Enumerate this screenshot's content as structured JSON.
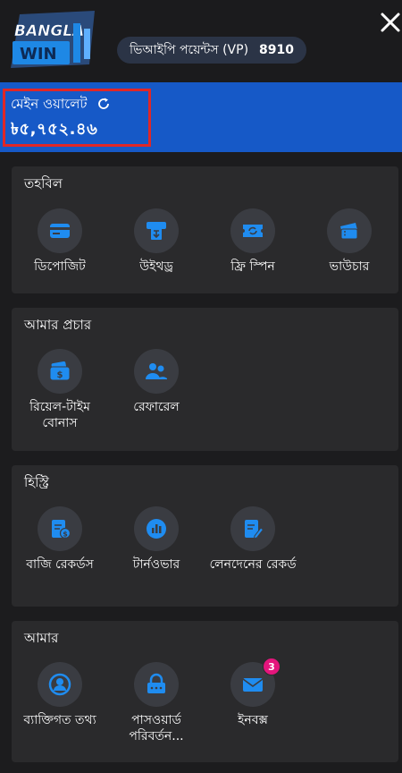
{
  "header": {
    "logo_text_top": "BANGLA",
    "logo_text_bottom": "WIN",
    "vip_label": "ভিআইপি পয়েন্টস (VP)",
    "vip_value": "8910",
    "close_icon": "close-icon"
  },
  "wallet": {
    "title": "মেইন ওয়ালেট",
    "amount": "৳৫,৭৫২.৪৬",
    "refresh_icon": "refresh-icon"
  },
  "sections": [
    {
      "title": "তহবিল",
      "items": [
        {
          "label": "ডিপোজিট",
          "icon": "card-icon"
        },
        {
          "label": "উইথড্র",
          "icon": "withdraw-icon"
        },
        {
          "label": "ফ্রি স্পিন",
          "icon": "ticket-icon"
        },
        {
          "label": "ভাউচার",
          "icon": "voucher-icon"
        }
      ]
    },
    {
      "title": "আমার প্রচার",
      "items": [
        {
          "label": "রিয়েল-টাইম বোনাস",
          "icon": "wallet-bonus-icon"
        },
        {
          "label": "রেফারেল",
          "icon": "referral-icon"
        }
      ]
    },
    {
      "title": "হিস্ট্রি",
      "items": [
        {
          "label": "বাজি রেকর্ডস",
          "icon": "bet-record-icon"
        },
        {
          "label": "টার্নওভার",
          "icon": "turnover-icon"
        },
        {
          "label": "লেনদেনের রেকর্ড",
          "icon": "transaction-record-icon"
        }
      ]
    },
    {
      "title": "আমার",
      "items": [
        {
          "label": "ব্যাক্তিগত তথ্য",
          "icon": "user-icon"
        },
        {
          "label": "পাসওয়ার্ড পরিবর্তন...",
          "icon": "lock-icon"
        },
        {
          "label": "ইনবক্স",
          "icon": "mail-icon",
          "badge": "3"
        }
      ]
    }
  ],
  "colors": {
    "accent": "#1f8cf0",
    "wallet_bg": "#1659c7",
    "highlight_border": "#e02727",
    "badge": "#e4157c"
  }
}
